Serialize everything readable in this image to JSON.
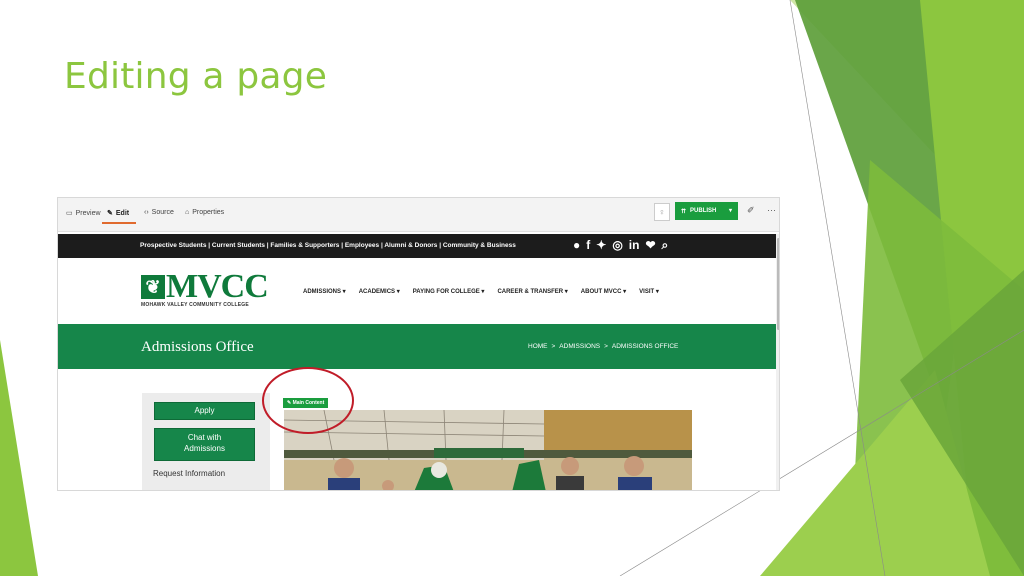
{
  "slide": {
    "title": "Editing a page"
  },
  "cms_toolbar": {
    "tabs": [
      {
        "icon": "monitor-icon",
        "label": "Preview"
      },
      {
        "icon": "pencil-icon",
        "label": "Edit"
      },
      {
        "icon": "code-icon",
        "label": "Source"
      },
      {
        "icon": "properties-icon",
        "label": "Properties"
      }
    ],
    "active_tab": "Edit",
    "publish_label": "PUBLISH",
    "publish_color": "#1a9d3e"
  },
  "site": {
    "top_nav": "Prospective Students | Current Students | Families & Supporters | Employees | Alumni & Donors | Community & Business",
    "social_icons": [
      "chat-icon",
      "facebook-icon",
      "twitter-icon",
      "instagram-icon",
      "linkedin-icon",
      "flickr-icon",
      "search-icon"
    ],
    "logo": {
      "word": "MVCC",
      "tagline": "MOHAWK VALLEY COMMUNITY COLLEGE"
    },
    "main_nav": [
      "ADMISSIONS",
      "ACADEMICS",
      "PAYING FOR COLLEGE",
      "CAREER & TRANSFER",
      "ABOUT MVCC",
      "VISIT"
    ],
    "banner_title": "Admissions Office",
    "breadcrumb": [
      "HOME",
      "ADMISSIONS",
      "ADMISSIONS OFFICE"
    ],
    "brand_green": "#16864a",
    "sidebar": {
      "apply_label": "Apply",
      "chat_label": "Chat with Admissions",
      "request_label": "Request Information"
    },
    "main_content_label": "Main Content"
  },
  "highlight_color": "#c01c28"
}
